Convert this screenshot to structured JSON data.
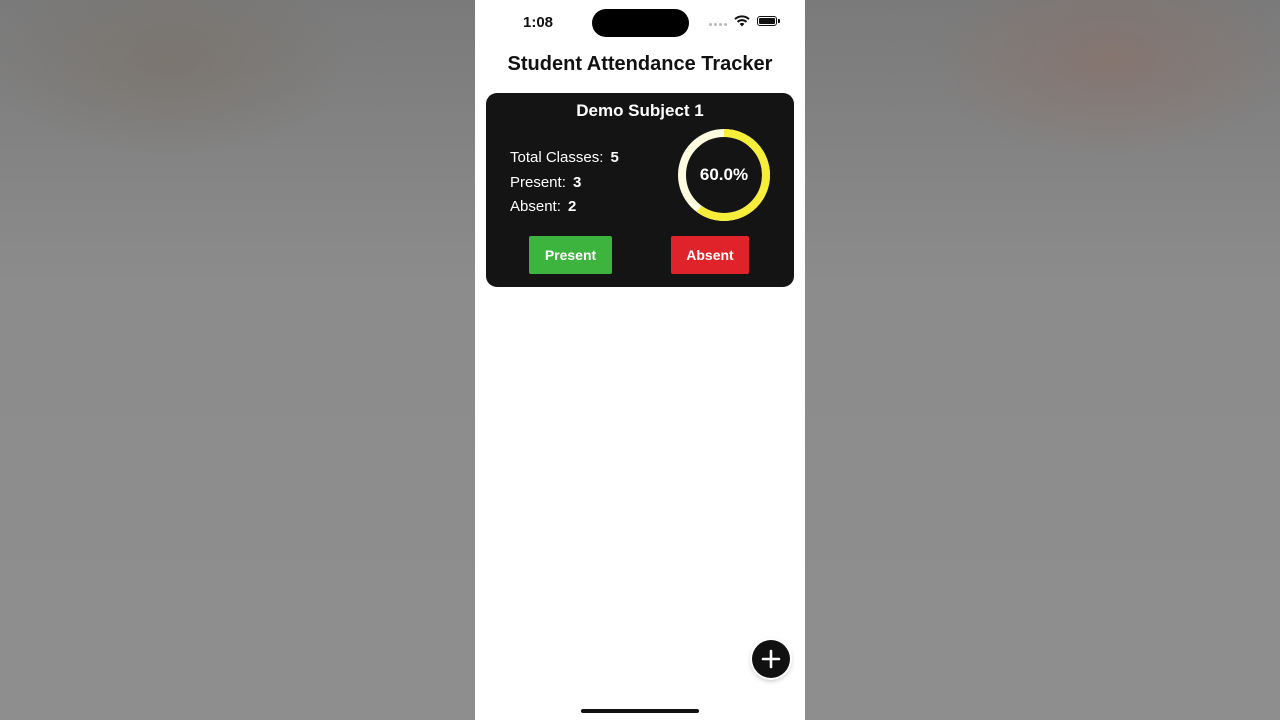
{
  "status_bar": {
    "time": "1:08",
    "icons": [
      "signal-icon",
      "wifi-icon",
      "battery-icon"
    ]
  },
  "app": {
    "title": "Student Attendance Tracker"
  },
  "subjects": [
    {
      "name": "Demo Subject 1",
      "total_label": "Total Classes:",
      "total_value": "5",
      "present_label": "Present:",
      "present_value": "3",
      "absent_label": "Absent:",
      "absent_value": "2",
      "percentage_text": "60.0%",
      "percentage_fraction": 0.6,
      "present_button": "Present",
      "absent_button": "Absent"
    }
  ],
  "fab": {
    "icon": "plus-icon"
  },
  "colors": {
    "card_background": "#141414",
    "progress": "#f7ee3b",
    "progress_track": "#fffbe0",
    "present_button": "#3db43d",
    "absent_button": "#e0232a"
  }
}
